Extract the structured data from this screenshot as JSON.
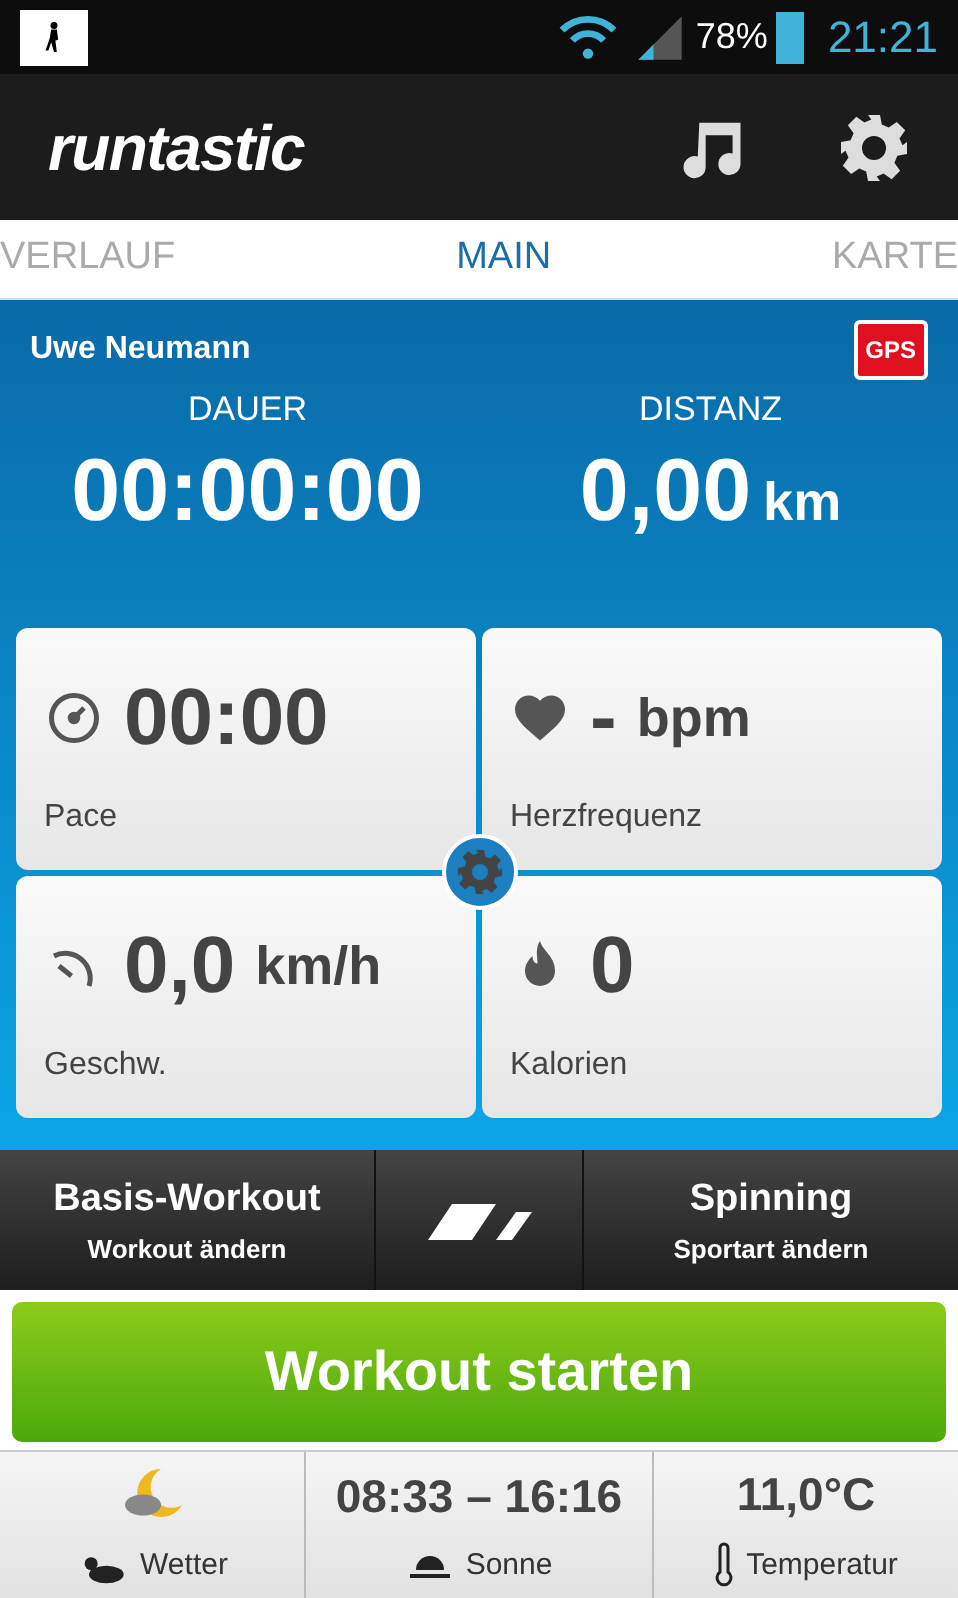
{
  "status_bar": {
    "battery": "78%",
    "time": "21:21"
  },
  "header": {
    "logo": "runtastic"
  },
  "tabs": [
    {
      "label": "VERLAUF",
      "selected": false
    },
    {
      "label": "MAIN",
      "selected": true
    },
    {
      "label": "KARTE",
      "selected": false
    }
  ],
  "user": {
    "name": "Uwe Neumann",
    "gps_badge": "GPS"
  },
  "metrics": [
    {
      "label": "DAUER",
      "value": "00:00:00"
    },
    {
      "label": "DISTANZ",
      "value": "0,00",
      "unit": "km"
    }
  ],
  "tiles": [
    {
      "value": "00:00",
      "label": "Pace"
    },
    {
      "value": "-",
      "unit": "bpm",
      "label": "Herzfrequenz"
    },
    {
      "value": "0,0",
      "unit": "km/h",
      "label": "Geschw."
    },
    {
      "value": "0",
      "label": "Kalorien"
    }
  ],
  "workout_bar": [
    {
      "title": "Basis-Workout",
      "subtitle": "Workout ändern"
    },
    {
      "title": "Spinning",
      "subtitle": "Sportart ändern"
    }
  ],
  "start_button": "Workout starten",
  "info_bar": [
    {
      "label": "Wetter"
    },
    {
      "value": "08:33 – 16:16",
      "label": "Sonne"
    },
    {
      "value": "11,0°C",
      "label": "Temperatur"
    }
  ]
}
